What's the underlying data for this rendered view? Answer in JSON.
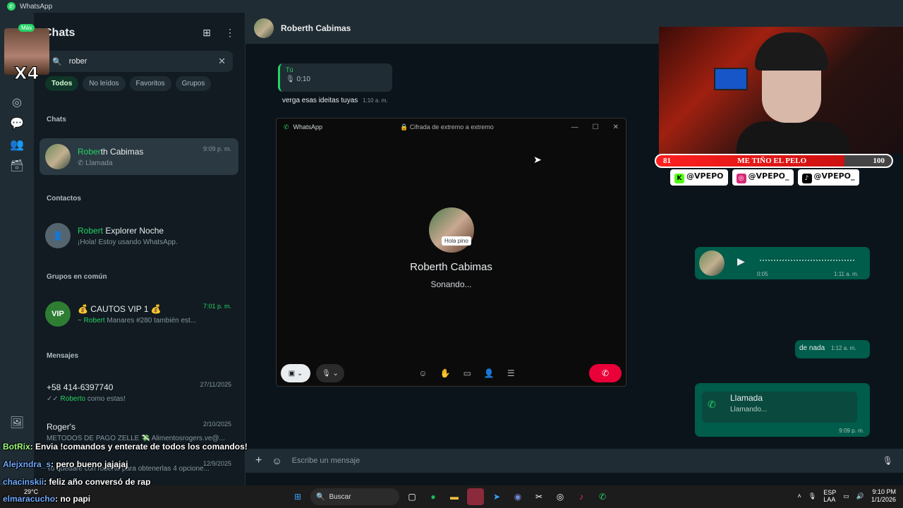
{
  "window": {
    "title": "WhatsApp"
  },
  "sidebar": {
    "title": "Chats",
    "search_value": "rober",
    "filters": [
      "Todos",
      "No leídos",
      "Favoritos",
      "Grupos"
    ],
    "sections": {
      "chats": "Chats",
      "contacts": "Contactos",
      "groups": "Grupos en común",
      "messages": "Mensajes"
    },
    "chat_item": {
      "name_hl": "Rober",
      "name_rest": "th Cabimas",
      "sub": "Llamada",
      "time": "9:09 p. m."
    },
    "contact_item": {
      "name_hl": "Robert",
      "name_rest": " Explorer Noche",
      "sub": "¡Hola! Estoy usando WhatsApp."
    },
    "group_item": {
      "name": "💰 CAUTOS VIP 1 💰",
      "sub_pre": "~ ",
      "sub_hl": "Robert",
      "sub_post": " Manares #280 también est...",
      "time": "7:01 p. m.",
      "avatar": "VIP"
    },
    "message_items": [
      {
        "name": "+58 414-6397740",
        "sub_hl": "Roberto",
        "sub_post": " como estas!",
        "time": "27/11/2025"
      },
      {
        "name": "Roger's",
        "sub": "METODOS DE PAGO ZELLE 💸 Alimentosrogers.ve@...",
        "time": "2/10/2025"
      },
      {
        "name": "",
        "sub": "Yo quedaré con roberto para obtenerlas 4 opcione...",
        "time": "12/9/2025"
      }
    ]
  },
  "chat": {
    "contact_name": "Roberth Cabimas",
    "voice_msg": {
      "sender": "Tú",
      "duration": "0:10"
    },
    "text_in": {
      "text": "verga esas ideitas tuyas",
      "time": "1:10 a. m."
    },
    "voice_out": {
      "duration": "0:05",
      "time": "1:11 a. m."
    },
    "text_out": {
      "text": "de nada",
      "time": "1:12 a. m."
    },
    "call_card": {
      "title": "Llamada",
      "status": "Llamando...",
      "time": "9:09 p. m."
    },
    "composer_placeholder": "Escribe un mensaje"
  },
  "call_window": {
    "app": "WhatsApp",
    "encryption": "Cifrada de extremo a extremo",
    "callee": "Roberth Cabimas",
    "status": "Sonando...",
    "avatar_tag": "Hola pino"
  },
  "overlay": {
    "goal_left": "81",
    "goal_text": "ME TIÑO EL PELO",
    "goal_right": "100",
    "goal_progress_percent": 80,
    "socials": [
      "@VPEPO",
      "@VPEPO_",
      "@VPEPO_"
    ],
    "emote": {
      "badge": "Más",
      "multiplier": "X4"
    },
    "chat_lines": [
      {
        "user": "BotRix",
        "msg": ": Envia !comandos y enterate de todos los comandos!"
      },
      {
        "user": "Alejxndra_s",
        "msg": ": pero bueno jajajaj"
      },
      {
        "user": "chacinskii",
        "msg": ": feliz año conversó de rap"
      },
      {
        "user": "elmaracucho",
        "msg": ": no papi"
      }
    ]
  },
  "taskbar": {
    "search_label": "Buscar",
    "weather": "29°C",
    "lang": "ESP",
    "lang2": "LAA",
    "time": "9:10 PM",
    "date": "1/1/2026"
  },
  "colors": {
    "accent": "#25d366",
    "hangup": "#ea0038",
    "bubble_out": "#005c4b"
  }
}
